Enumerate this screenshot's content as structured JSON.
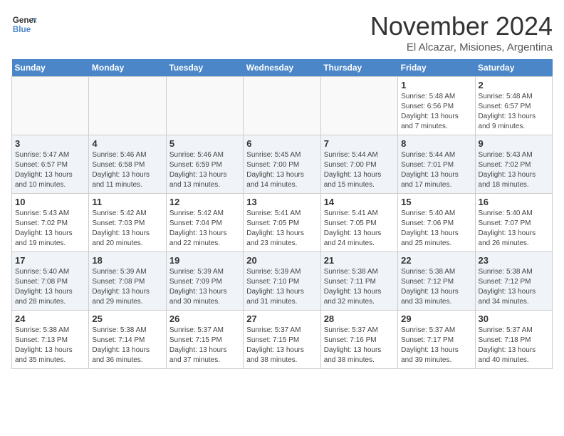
{
  "logo": {
    "line1": "General",
    "line2": "Blue"
  },
  "title": "November 2024",
  "subtitle": "El Alcazar, Misiones, Argentina",
  "days_of_week": [
    "Sunday",
    "Monday",
    "Tuesday",
    "Wednesday",
    "Thursday",
    "Friday",
    "Saturday"
  ],
  "weeks": [
    [
      {
        "day": "",
        "info": ""
      },
      {
        "day": "",
        "info": ""
      },
      {
        "day": "",
        "info": ""
      },
      {
        "day": "",
        "info": ""
      },
      {
        "day": "",
        "info": ""
      },
      {
        "day": "1",
        "info": "Sunrise: 5:48 AM\nSunset: 6:56 PM\nDaylight: 13 hours and 7 minutes."
      },
      {
        "day": "2",
        "info": "Sunrise: 5:48 AM\nSunset: 6:57 PM\nDaylight: 13 hours and 9 minutes."
      }
    ],
    [
      {
        "day": "3",
        "info": "Sunrise: 5:47 AM\nSunset: 6:57 PM\nDaylight: 13 hours and 10 minutes."
      },
      {
        "day": "4",
        "info": "Sunrise: 5:46 AM\nSunset: 6:58 PM\nDaylight: 13 hours and 11 minutes."
      },
      {
        "day": "5",
        "info": "Sunrise: 5:46 AM\nSunset: 6:59 PM\nDaylight: 13 hours and 13 minutes."
      },
      {
        "day": "6",
        "info": "Sunrise: 5:45 AM\nSunset: 7:00 PM\nDaylight: 13 hours and 14 minutes."
      },
      {
        "day": "7",
        "info": "Sunrise: 5:44 AM\nSunset: 7:00 PM\nDaylight: 13 hours and 15 minutes."
      },
      {
        "day": "8",
        "info": "Sunrise: 5:44 AM\nSunset: 7:01 PM\nDaylight: 13 hours and 17 minutes."
      },
      {
        "day": "9",
        "info": "Sunrise: 5:43 AM\nSunset: 7:02 PM\nDaylight: 13 hours and 18 minutes."
      }
    ],
    [
      {
        "day": "10",
        "info": "Sunrise: 5:43 AM\nSunset: 7:02 PM\nDaylight: 13 hours and 19 minutes."
      },
      {
        "day": "11",
        "info": "Sunrise: 5:42 AM\nSunset: 7:03 PM\nDaylight: 13 hours and 20 minutes."
      },
      {
        "day": "12",
        "info": "Sunrise: 5:42 AM\nSunset: 7:04 PM\nDaylight: 13 hours and 22 minutes."
      },
      {
        "day": "13",
        "info": "Sunrise: 5:41 AM\nSunset: 7:05 PM\nDaylight: 13 hours and 23 minutes."
      },
      {
        "day": "14",
        "info": "Sunrise: 5:41 AM\nSunset: 7:05 PM\nDaylight: 13 hours and 24 minutes."
      },
      {
        "day": "15",
        "info": "Sunrise: 5:40 AM\nSunset: 7:06 PM\nDaylight: 13 hours and 25 minutes."
      },
      {
        "day": "16",
        "info": "Sunrise: 5:40 AM\nSunset: 7:07 PM\nDaylight: 13 hours and 26 minutes."
      }
    ],
    [
      {
        "day": "17",
        "info": "Sunrise: 5:40 AM\nSunset: 7:08 PM\nDaylight: 13 hours and 28 minutes."
      },
      {
        "day": "18",
        "info": "Sunrise: 5:39 AM\nSunset: 7:08 PM\nDaylight: 13 hours and 29 minutes."
      },
      {
        "day": "19",
        "info": "Sunrise: 5:39 AM\nSunset: 7:09 PM\nDaylight: 13 hours and 30 minutes."
      },
      {
        "day": "20",
        "info": "Sunrise: 5:39 AM\nSunset: 7:10 PM\nDaylight: 13 hours and 31 minutes."
      },
      {
        "day": "21",
        "info": "Sunrise: 5:38 AM\nSunset: 7:11 PM\nDaylight: 13 hours and 32 minutes."
      },
      {
        "day": "22",
        "info": "Sunrise: 5:38 AM\nSunset: 7:12 PM\nDaylight: 13 hours and 33 minutes."
      },
      {
        "day": "23",
        "info": "Sunrise: 5:38 AM\nSunset: 7:12 PM\nDaylight: 13 hours and 34 minutes."
      }
    ],
    [
      {
        "day": "24",
        "info": "Sunrise: 5:38 AM\nSunset: 7:13 PM\nDaylight: 13 hours and 35 minutes."
      },
      {
        "day": "25",
        "info": "Sunrise: 5:38 AM\nSunset: 7:14 PM\nDaylight: 13 hours and 36 minutes."
      },
      {
        "day": "26",
        "info": "Sunrise: 5:37 AM\nSunset: 7:15 PM\nDaylight: 13 hours and 37 minutes."
      },
      {
        "day": "27",
        "info": "Sunrise: 5:37 AM\nSunset: 7:15 PM\nDaylight: 13 hours and 38 minutes."
      },
      {
        "day": "28",
        "info": "Sunrise: 5:37 AM\nSunset: 7:16 PM\nDaylight: 13 hours and 38 minutes."
      },
      {
        "day": "29",
        "info": "Sunrise: 5:37 AM\nSunset: 7:17 PM\nDaylight: 13 hours and 39 minutes."
      },
      {
        "day": "30",
        "info": "Sunrise: 5:37 AM\nSunset: 7:18 PM\nDaylight: 13 hours and 40 minutes."
      }
    ]
  ]
}
